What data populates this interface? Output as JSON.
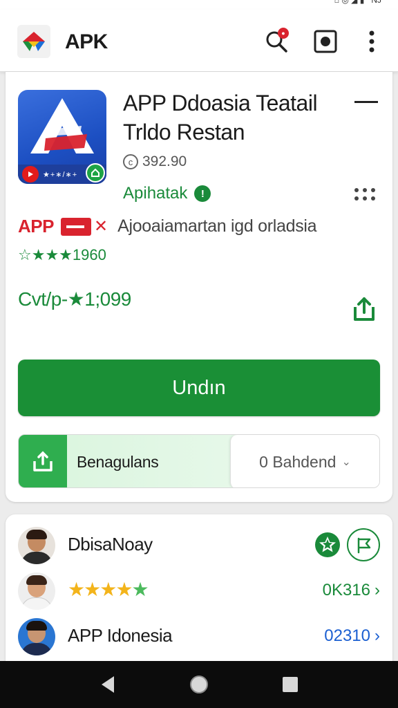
{
  "status_bar": {
    "right_text": "NJ"
  },
  "app_bar": {
    "title": "APK"
  },
  "app": {
    "name": "APP Ddoasia  Teatail Trldo Restan",
    "size": "392.90",
    "developer": "Apihatak",
    "strip_text": "★+∗/∗+"
  },
  "promo": {
    "brand": "APP",
    "description": "Ajooaiamartan igd orladsia",
    "rating_text": "☆★★★1960"
  },
  "price": {
    "text": "Cvt/p-★1;099"
  },
  "install_button": {
    "label": "Undın"
  },
  "download": {
    "label": "Benagulans",
    "dropdown_value": "0 Bahdend"
  },
  "list": [
    {
      "title": "DbisaNoay"
    },
    {
      "rating_stars": 4.5,
      "value": "0K316"
    },
    {
      "title": "APP Idonesia",
      "value": "02310"
    }
  ],
  "colors": {
    "accent_green": "#1a8f36",
    "text_green": "#1a8a3a",
    "brand_red": "#d9232e",
    "link_blue": "#1b5fd1",
    "star_yellow": "#f3b41b"
  },
  "icons": {
    "logo": "apk-logo-icon",
    "search": "search-icon",
    "screenshot": "screenshot-icon",
    "menu": "more-vert-icon",
    "share": "share-icon",
    "download": "download-icon",
    "star": "star-icon",
    "flag": "flag-icon"
  }
}
